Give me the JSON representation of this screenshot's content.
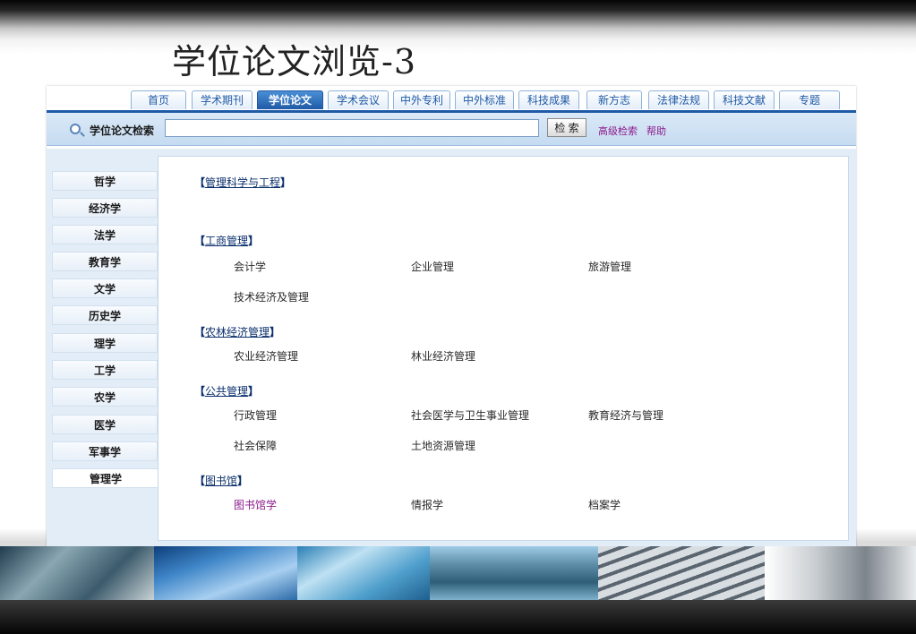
{
  "slide": {
    "title": "学位论文浏览-3"
  },
  "nav": {
    "tabs": [
      "首页",
      "学术期刊",
      "学位论文",
      "学术会议",
      "中外专利",
      "中外标准",
      "科技成果",
      "新方志",
      "法律法规",
      "科技文献",
      "专题"
    ],
    "active": "学位论文"
  },
  "search": {
    "label": "学位论文检索",
    "query": "",
    "button": "检 索",
    "advanced": "高级检索",
    "help": "帮助"
  },
  "sidebar": {
    "items": [
      "哲学",
      "经济学",
      "法学",
      "教育学",
      "文学",
      "历史学",
      "理学",
      "工学",
      "农学",
      "医学",
      "军事学",
      "管理学"
    ],
    "active": "管理学"
  },
  "categories": [
    {
      "open": "【",
      "name": "管理科学与工程",
      "close": "】",
      "subs": []
    },
    {
      "open": "【",
      "name": "工商管理",
      "close": "】",
      "subs": [
        "会计学",
        "企业管理",
        "旅游管理",
        "技术经济及管理"
      ]
    },
    {
      "open": "【",
      "name": "农林经济管理",
      "close": "】",
      "subs": [
        "农业经济管理",
        "林业经济管理"
      ]
    },
    {
      "open": "【",
      "name": "公共管理",
      "close": "】",
      "subs": [
        "行政管理",
        "社会医学与卫生事业管理",
        "教育经济与管理",
        "社会保障",
        "土地资源管理"
      ]
    },
    {
      "open": "【",
      "name": "图书馆",
      "close": "】",
      "subs": [
        "图书馆学",
        "情报学",
        "档案学"
      ]
    }
  ],
  "colors": {
    "accent": "#1f5aa6",
    "visited": "#8b1a8b",
    "panel": "#e3edf8"
  }
}
